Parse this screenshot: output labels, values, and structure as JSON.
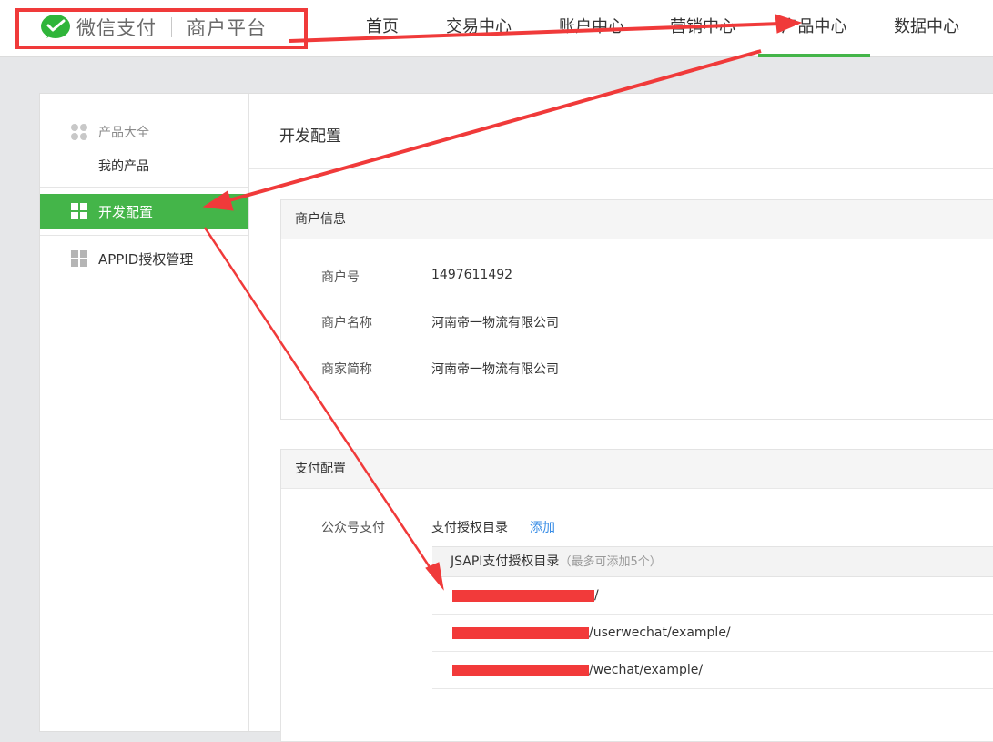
{
  "brand": {
    "name": "微信支付",
    "platform": "商户平台",
    "accent_color": "#44b549",
    "logo_icon": "wechat-pay-icon"
  },
  "nav": {
    "items": [
      {
        "label": "首页"
      },
      {
        "label": "交易中心"
      },
      {
        "label": "账户中心"
      },
      {
        "label": "营销中心"
      },
      {
        "label": "产品中心",
        "active": true
      },
      {
        "label": "数据中心"
      }
    ]
  },
  "sidebar": {
    "group_title": "产品大全",
    "group_icon": "dots-grid-icon",
    "my_products": "我的产品",
    "items": [
      {
        "label": "开发配置",
        "active": true,
        "icon": "grid-icon"
      },
      {
        "label": "APPID授权管理",
        "active": false,
        "icon": "grid-icon"
      }
    ]
  },
  "main": {
    "title": "开发配置",
    "merchant_card": {
      "title": "商户信息",
      "rows": [
        {
          "label": "商户号",
          "value": "1497611492"
        },
        {
          "label": "商户名称",
          "value": "河南帝一物流有限公司"
        },
        {
          "label": "商家简称",
          "value": "河南帝一物流有限公司"
        }
      ]
    },
    "payment_card": {
      "title": "支付配置",
      "label": "公众号支付",
      "sub_label": "支付授权目录",
      "add_link": "添加",
      "table_header": "JSAPI支付授权目录",
      "table_hint": "（最多可添加5个）",
      "rows": [
        {
          "suffix": "/"
        },
        {
          "suffix": "/userwechat/example/"
        },
        {
          "suffix": "/wechat/example/"
        }
      ]
    }
  },
  "annotation_color": "#f03a3a"
}
